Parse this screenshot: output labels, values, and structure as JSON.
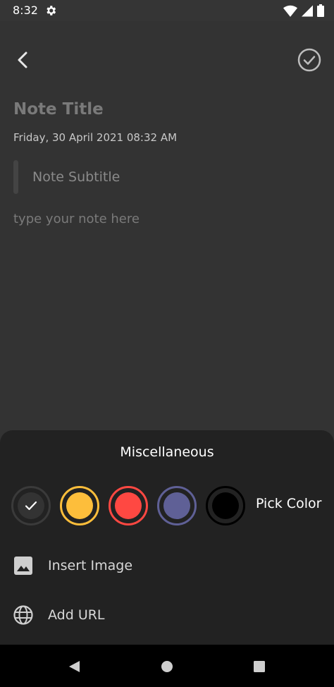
{
  "status_bar": {
    "time": "8:32",
    "icons": [
      "gear-icon",
      "wifi-icon",
      "signal-icon",
      "battery-icon"
    ]
  },
  "toolbar": {
    "back_icon": "chevron-left-icon",
    "done_icon": "check-circle-icon"
  },
  "note": {
    "title_placeholder": "Note Title",
    "datetime": "Friday, 30 April 2021 08:32 AM",
    "subtitle_placeholder": "Note Subtitle",
    "body_placeholder": "type your note here"
  },
  "misc_sheet": {
    "title": "Miscellaneous",
    "colors": [
      {
        "name": "default",
        "color": "#333333",
        "ring": "#3a3a3a",
        "selected": true
      },
      {
        "name": "yellow",
        "color": "#FDBE3B",
        "ring": "#FDBE3B",
        "selected": false
      },
      {
        "name": "red",
        "color": "#FF4842",
        "ring": "#FF4842",
        "selected": false
      },
      {
        "name": "indigo",
        "color": "#5F6096",
        "ring": "#5F6096",
        "selected": false
      },
      {
        "name": "black",
        "color": "#000000",
        "ring": "#000000",
        "selected": false
      }
    ],
    "pick_color_label": "Pick Color",
    "options": [
      {
        "label": "Insert Image",
        "icon": "image-icon"
      },
      {
        "label": "Add URL",
        "icon": "globe-icon"
      }
    ]
  },
  "nav_bar": {
    "buttons": [
      "back-triangle-icon",
      "home-circle-icon",
      "recents-square-icon"
    ]
  }
}
